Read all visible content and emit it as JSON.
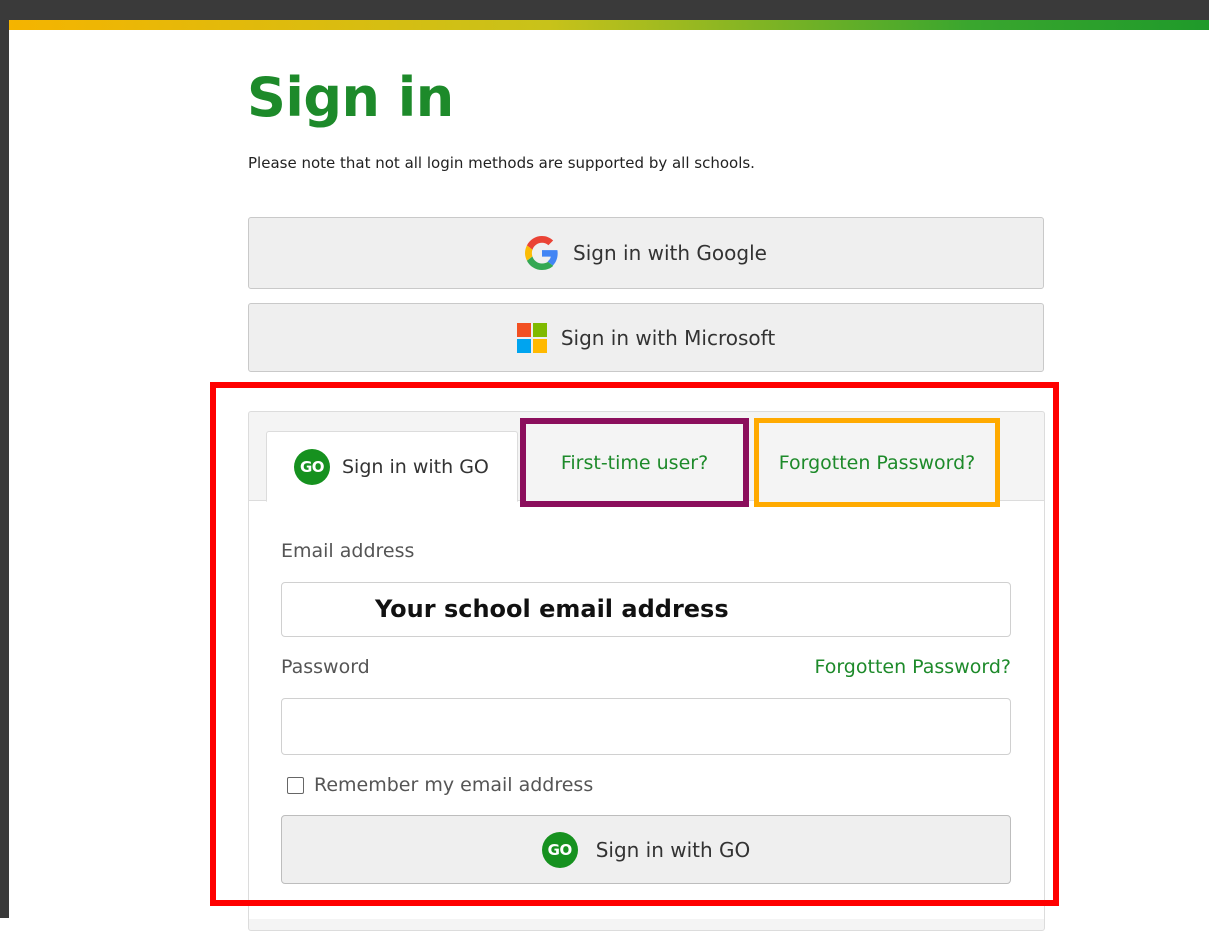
{
  "page": {
    "title": "Sign in",
    "note": "Please note that not all login methods are supported by all schools."
  },
  "sso": {
    "google_label": "Sign in with Google",
    "microsoft_label": "Sign in with Microsoft"
  },
  "tabs": [
    {
      "label": "Sign in with GO",
      "active": true
    },
    {
      "label": "First-time user?"
    },
    {
      "label": "Forgotten Password?"
    }
  ],
  "form": {
    "email_label": "Email address",
    "email_value": "Your school email address",
    "password_label": "Password",
    "forgot_link": "Forgotten Password?",
    "remember_label": "Remember my email address",
    "submit_label": "Sign in with GO",
    "go_icon_text": "GO"
  },
  "colors": {
    "brand_green": "#1d8a2a",
    "highlight_red": "#ff0000",
    "highlight_purple": "#8b0e5c",
    "highlight_orange": "#ffaa00"
  },
  "icons": [
    "google-icon",
    "microsoft-icon",
    "go-icon"
  ]
}
